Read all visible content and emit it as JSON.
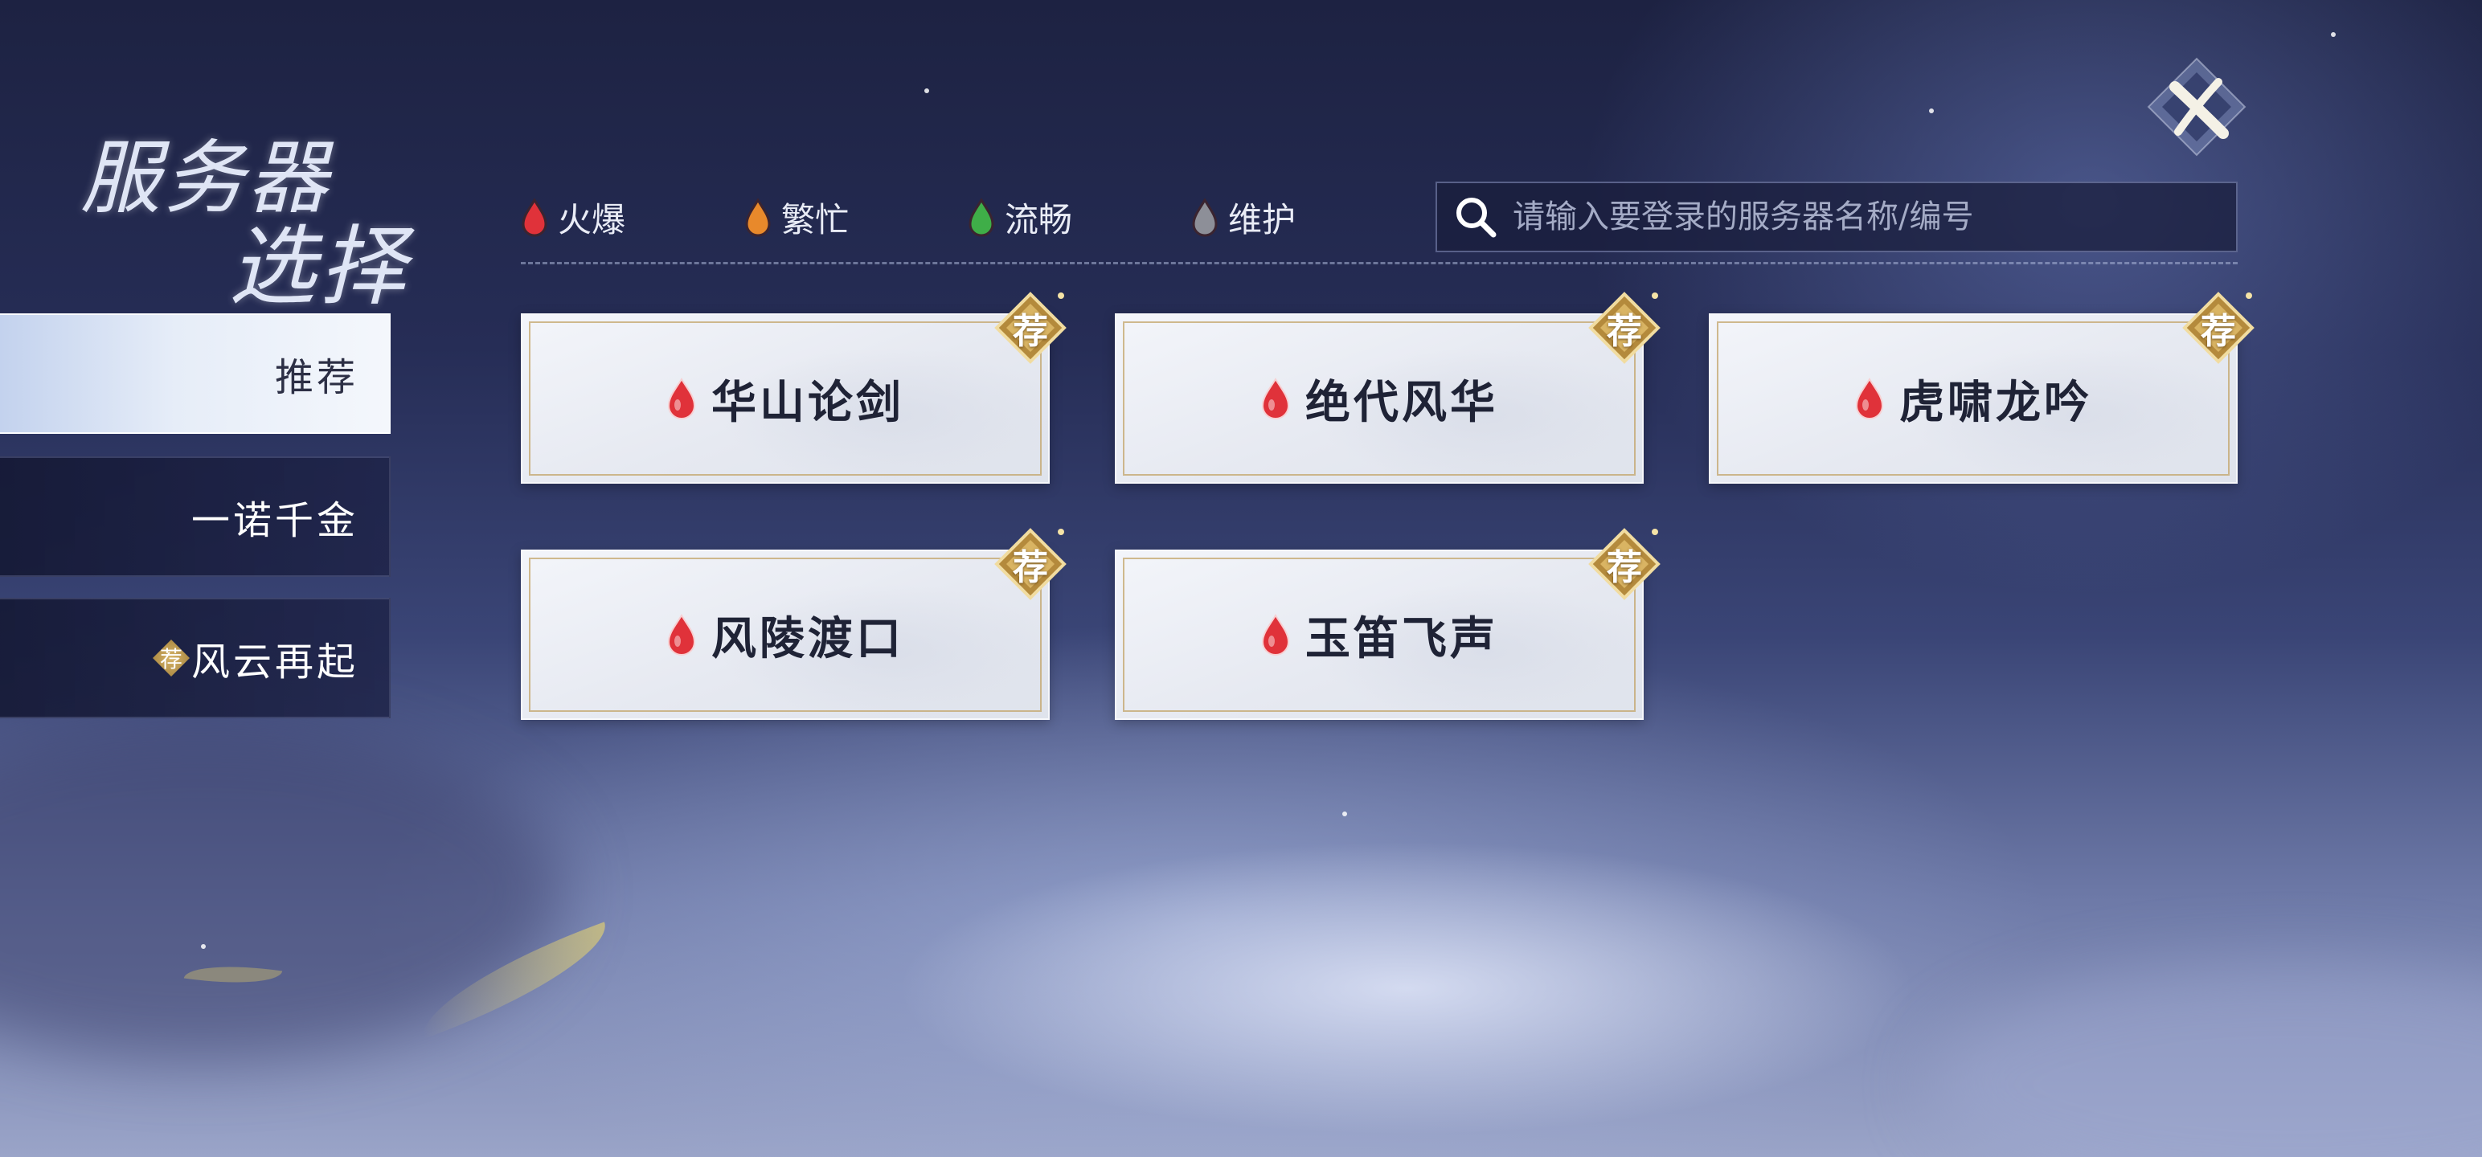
{
  "title": {
    "line1": "服务器",
    "line2": "选择"
  },
  "close": {
    "icon": "close-brush-icon"
  },
  "colors": {
    "hot": "#e0323a",
    "busy": "#e8892b",
    "smooth": "#3fae48",
    "maintenance": "#8d8f98",
    "gold": "#c9a55a"
  },
  "sidebar": {
    "items": [
      {
        "label": "推荐",
        "active": true,
        "badge": ""
      },
      {
        "label": "一诺千金",
        "active": false,
        "badge": ""
      },
      {
        "label": "风云再起",
        "active": false,
        "badge": "荐"
      }
    ]
  },
  "legend": {
    "items": [
      {
        "label": "火爆",
        "status": "hot"
      },
      {
        "label": "繁忙",
        "status": "busy"
      },
      {
        "label": "流畅",
        "status": "smooth"
      },
      {
        "label": "维护",
        "status": "maintenance"
      }
    ]
  },
  "search": {
    "placeholder": "请输入要登录的服务器名称/编号",
    "value": "",
    "icon": "search-icon"
  },
  "servers": [
    {
      "name": "华山论剑",
      "status": "hot",
      "badge": "荐"
    },
    {
      "name": "绝代风华",
      "status": "hot",
      "badge": "荐"
    },
    {
      "name": "虎啸龙吟",
      "status": "hot",
      "badge": "荐"
    },
    {
      "name": "风陵渡口",
      "status": "hot",
      "badge": "荐"
    },
    {
      "name": "玉笛飞声",
      "status": "hot",
      "badge": "荐"
    }
  ]
}
